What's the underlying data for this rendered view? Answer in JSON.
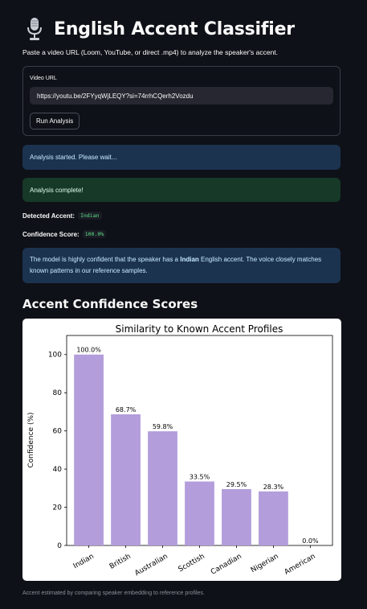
{
  "header": {
    "title": "English Accent Classifier",
    "subtitle": "Paste a video URL (Loom, YouTube, or direct .mp4) to analyze the speaker's accent.",
    "mic_icon": "microphone-icon"
  },
  "form": {
    "label": "Video URL",
    "url_value": "https://youtu.be/2FYyqWjLEQY?si=74rrhCQerh2Vozdu",
    "run_label": "Run Analysis"
  },
  "alerts": {
    "started": "Analysis started. Please wait...",
    "complete": "Analysis complete!"
  },
  "results": {
    "accent_label": "Detected Accent:",
    "accent_value": "Indian",
    "confidence_label": "Confidence Score:",
    "confidence_value": "100.0%",
    "explain_pre": "The model is highly confident that the speaker has a ",
    "explain_accent": "Indian",
    "explain_post": " English accent. The voice closely matches known patterns in our reference samples."
  },
  "section_title": "Accent Confidence Scores",
  "chart_data": {
    "type": "bar",
    "title": "Similarity to Known Accent Profiles",
    "xlabel": "",
    "ylabel": "Confidence (%)",
    "categories": [
      "Indian",
      "British",
      "Australian",
      "Scottish",
      "Canadian",
      "Nigerian",
      "American"
    ],
    "values": [
      100.0,
      68.7,
      59.8,
      33.5,
      29.5,
      28.3,
      0.0
    ],
    "value_labels": [
      "100.0%",
      "68.7%",
      "59.8%",
      "33.5%",
      "29.5%",
      "28.3%",
      "0.0%"
    ],
    "yticks": [
      "0",
      "20",
      "40",
      "60",
      "80",
      "100"
    ],
    "ylim": [
      0,
      110
    ],
    "bar_color": "#b39ddb",
    "grid": false,
    "legend": "none"
  },
  "footer": "Accent estimated by comparing speaker embedding to reference profiles.",
  "colors": {
    "background": "#0e1117",
    "info_bg": "#1c3350",
    "success_bg": "#173928",
    "code_green": "#5ce488",
    "bar": "#b39ddb"
  }
}
